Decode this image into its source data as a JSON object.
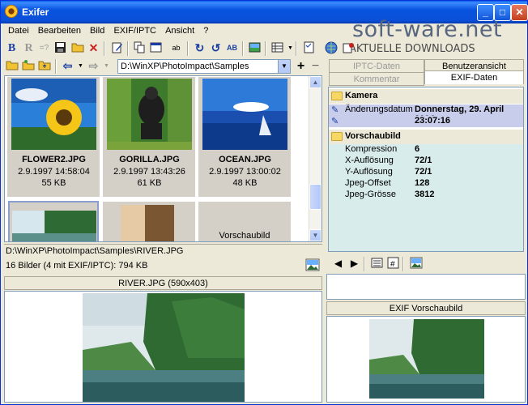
{
  "window": {
    "title": "Exifer"
  },
  "watermark": {
    "brand": "soft-ware.net",
    "tagline": "AKTUELLE DOWNLOADS"
  },
  "menu": [
    {
      "label": "Datei"
    },
    {
      "label": "Bearbeiten"
    },
    {
      "label": "Bild"
    },
    {
      "label": "EXIF/IPTC"
    },
    {
      "label": "Ansicht"
    },
    {
      "label": "?"
    }
  ],
  "toolbar": {
    "path_value": "D:\\WinXP\\PhotoImpact\\Samples"
  },
  "thumbnails": [
    {
      "name": "FLOWER2.JPG",
      "date": "2.9.1997 14:58:04",
      "size": "55 KB"
    },
    {
      "name": "GORILLA.JPG",
      "date": "2.9.1997 13:43:26",
      "size": "61 KB"
    },
    {
      "name": "OCEAN.JPG",
      "date": "2.9.1997 13:00:02",
      "size": "48 KB"
    },
    {
      "name": "",
      "date": "",
      "size": ""
    },
    {
      "name": "",
      "date": "",
      "size": ""
    },
    {
      "name": "Vorschaubild",
      "date": "",
      "size": ""
    }
  ],
  "status": {
    "path": "D:\\WinXP\\PhotoImpact\\Samples\\RIVER.JPG",
    "summary": "16 Bilder (4 mit EXIF/IPTC): 794 KB"
  },
  "preview": {
    "header": "RIVER.JPG (590x403)"
  },
  "right_panel": {
    "tabs_top": [
      "IPTC-Daten",
      "Benutzeransicht"
    ],
    "tabs_bottom": [
      "Kommentar",
      "EXIF-Daten"
    ],
    "groups": [
      {
        "title": "Kamera",
        "rows": [
          {
            "key": "Änderungsdatum",
            "value": "Donnerstag, 29. April 2004"
          },
          {
            "key": "",
            "value": "23:07:16"
          }
        ]
      },
      {
        "title": "Vorschaubild",
        "rows": [
          {
            "key": "Kompression",
            "value": "6"
          },
          {
            "key": "X-Auflösung",
            "value": "72/1"
          },
          {
            "key": "Y-Auflösung",
            "value": "72/1"
          },
          {
            "key": "Jpeg-Offset",
            "value": "128"
          },
          {
            "key": "Jpeg-Grösse",
            "value": "3812"
          }
        ]
      }
    ],
    "preview_header": "EXIF Vorschaubild"
  }
}
